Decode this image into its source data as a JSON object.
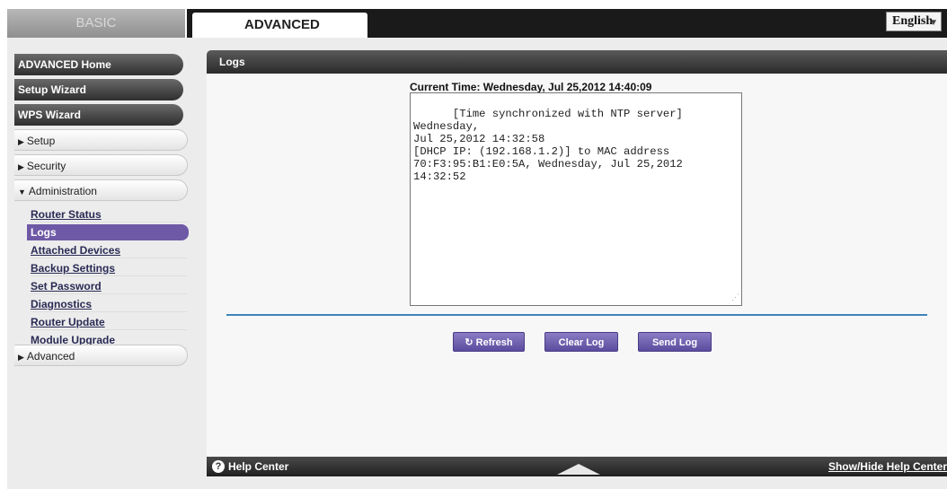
{
  "tabs": {
    "basic": "BASIC",
    "advanced": "ADVANCED"
  },
  "language": {
    "selected": "English"
  },
  "sidebar": {
    "dark_items": [
      "ADVANCED Home",
      "Setup Wizard",
      "WPS Wizard"
    ],
    "sections": [
      "Setup",
      "Security",
      "Administration"
    ],
    "admin_links": [
      "Router Status",
      "Logs",
      "Attached Devices",
      "Backup Settings",
      "Set Password",
      "Diagnostics",
      "Router Update",
      "Module Upgrade"
    ],
    "advanced_section": "Advanced"
  },
  "main": {
    "title": "Logs",
    "current_time": "Current Time: Wednesday, Jul 25,2012 14:40:09",
    "log_text": "[Time synchronized with NTP server] Wednesday,\nJul 25,2012 14:32:58\n[DHCP IP: (192.168.1.2)] to MAC address\n70:F3:95:B1:E0:5A, Wednesday, Jul 25,2012\n14:32:52",
    "buttons": {
      "refresh": "Refresh",
      "clear": "Clear Log",
      "send": "Send Log"
    }
  },
  "help": {
    "label": "Help Center",
    "toggle": "Show/Hide Help Center"
  },
  "colors": {
    "accent": "#6e59a6",
    "divider": "#3d84b8",
    "header": "#2a2a2a"
  }
}
